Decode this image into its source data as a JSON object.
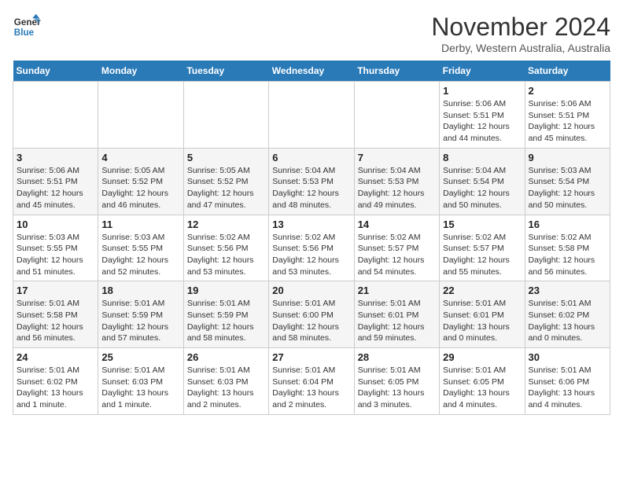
{
  "logo": {
    "line1": "General",
    "line2": "Blue"
  },
  "title": "November 2024",
  "location": "Derby, Western Australia, Australia",
  "days_of_week": [
    "Sunday",
    "Monday",
    "Tuesday",
    "Wednesday",
    "Thursday",
    "Friday",
    "Saturday"
  ],
  "weeks": [
    [
      {
        "day": "",
        "info": ""
      },
      {
        "day": "",
        "info": ""
      },
      {
        "day": "",
        "info": ""
      },
      {
        "day": "",
        "info": ""
      },
      {
        "day": "",
        "info": ""
      },
      {
        "day": "1",
        "info": "Sunrise: 5:06 AM\nSunset: 5:51 PM\nDaylight: 12 hours\nand 44 minutes."
      },
      {
        "day": "2",
        "info": "Sunrise: 5:06 AM\nSunset: 5:51 PM\nDaylight: 12 hours\nand 45 minutes."
      }
    ],
    [
      {
        "day": "3",
        "info": "Sunrise: 5:06 AM\nSunset: 5:51 PM\nDaylight: 12 hours\nand 45 minutes."
      },
      {
        "day": "4",
        "info": "Sunrise: 5:05 AM\nSunset: 5:52 PM\nDaylight: 12 hours\nand 46 minutes."
      },
      {
        "day": "5",
        "info": "Sunrise: 5:05 AM\nSunset: 5:52 PM\nDaylight: 12 hours\nand 47 minutes."
      },
      {
        "day": "6",
        "info": "Sunrise: 5:04 AM\nSunset: 5:53 PM\nDaylight: 12 hours\nand 48 minutes."
      },
      {
        "day": "7",
        "info": "Sunrise: 5:04 AM\nSunset: 5:53 PM\nDaylight: 12 hours\nand 49 minutes."
      },
      {
        "day": "8",
        "info": "Sunrise: 5:04 AM\nSunset: 5:54 PM\nDaylight: 12 hours\nand 50 minutes."
      },
      {
        "day": "9",
        "info": "Sunrise: 5:03 AM\nSunset: 5:54 PM\nDaylight: 12 hours\nand 50 minutes."
      }
    ],
    [
      {
        "day": "10",
        "info": "Sunrise: 5:03 AM\nSunset: 5:55 PM\nDaylight: 12 hours\nand 51 minutes."
      },
      {
        "day": "11",
        "info": "Sunrise: 5:03 AM\nSunset: 5:55 PM\nDaylight: 12 hours\nand 52 minutes."
      },
      {
        "day": "12",
        "info": "Sunrise: 5:02 AM\nSunset: 5:56 PM\nDaylight: 12 hours\nand 53 minutes."
      },
      {
        "day": "13",
        "info": "Sunrise: 5:02 AM\nSunset: 5:56 PM\nDaylight: 12 hours\nand 53 minutes."
      },
      {
        "day": "14",
        "info": "Sunrise: 5:02 AM\nSunset: 5:57 PM\nDaylight: 12 hours\nand 54 minutes."
      },
      {
        "day": "15",
        "info": "Sunrise: 5:02 AM\nSunset: 5:57 PM\nDaylight: 12 hours\nand 55 minutes."
      },
      {
        "day": "16",
        "info": "Sunrise: 5:02 AM\nSunset: 5:58 PM\nDaylight: 12 hours\nand 56 minutes."
      }
    ],
    [
      {
        "day": "17",
        "info": "Sunrise: 5:01 AM\nSunset: 5:58 PM\nDaylight: 12 hours\nand 56 minutes."
      },
      {
        "day": "18",
        "info": "Sunrise: 5:01 AM\nSunset: 5:59 PM\nDaylight: 12 hours\nand 57 minutes."
      },
      {
        "day": "19",
        "info": "Sunrise: 5:01 AM\nSunset: 5:59 PM\nDaylight: 12 hours\nand 58 minutes."
      },
      {
        "day": "20",
        "info": "Sunrise: 5:01 AM\nSunset: 6:00 PM\nDaylight: 12 hours\nand 58 minutes."
      },
      {
        "day": "21",
        "info": "Sunrise: 5:01 AM\nSunset: 6:01 PM\nDaylight: 12 hours\nand 59 minutes."
      },
      {
        "day": "22",
        "info": "Sunrise: 5:01 AM\nSunset: 6:01 PM\nDaylight: 13 hours\nand 0 minutes."
      },
      {
        "day": "23",
        "info": "Sunrise: 5:01 AM\nSunset: 6:02 PM\nDaylight: 13 hours\nand 0 minutes."
      }
    ],
    [
      {
        "day": "24",
        "info": "Sunrise: 5:01 AM\nSunset: 6:02 PM\nDaylight: 13 hours\nand 1 minute."
      },
      {
        "day": "25",
        "info": "Sunrise: 5:01 AM\nSunset: 6:03 PM\nDaylight: 13 hours\nand 1 minute."
      },
      {
        "day": "26",
        "info": "Sunrise: 5:01 AM\nSunset: 6:03 PM\nDaylight: 13 hours\nand 2 minutes."
      },
      {
        "day": "27",
        "info": "Sunrise: 5:01 AM\nSunset: 6:04 PM\nDaylight: 13 hours\nand 2 minutes."
      },
      {
        "day": "28",
        "info": "Sunrise: 5:01 AM\nSunset: 6:05 PM\nDaylight: 13 hours\nand 3 minutes."
      },
      {
        "day": "29",
        "info": "Sunrise: 5:01 AM\nSunset: 6:05 PM\nDaylight: 13 hours\nand 4 minutes."
      },
      {
        "day": "30",
        "info": "Sunrise: 5:01 AM\nSunset: 6:06 PM\nDaylight: 13 hours\nand 4 minutes."
      }
    ]
  ]
}
